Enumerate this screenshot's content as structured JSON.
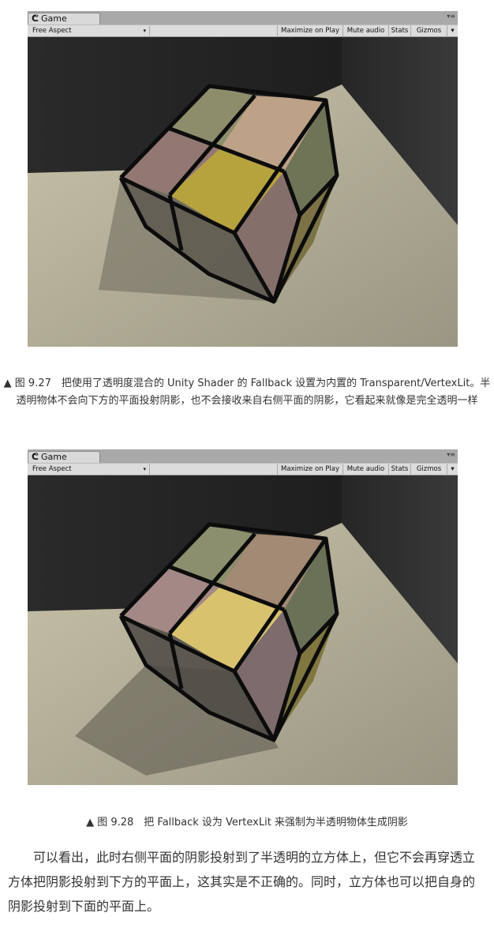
{
  "panels": [
    {
      "tab": {
        "icon": "unity-icon",
        "label": "Game"
      },
      "toolbar": {
        "aspect": "Free Aspect",
        "maximize": "Maximize on Play",
        "mute": "Mute audio",
        "stats": "Stats",
        "gizmos": "Gizmos"
      },
      "colors": {
        "face_top_left": "#8d8d6c",
        "face_top_right": "#bda288",
        "face_front_left": "#937772",
        "face_front_right": "#b7a33e",
        "side_top": "#6f7457",
        "side_bottom_left": "#856f6a",
        "side_bottom_right": "#7c7245"
      }
    },
    {
      "tab": {
        "icon": "unity-icon",
        "label": "Game"
      },
      "toolbar": {
        "aspect": "Free Aspect",
        "maximize": "Maximize on Play",
        "mute": "Mute audio",
        "stats": "Stats",
        "gizmos": "Gizmos"
      },
      "colors": {
        "face_top_left": "#8b8f6d",
        "face_top_right": "#a38a74",
        "face_front_left": "#a48885",
        "face_front_right": "#d9c26e",
        "side_top": "#6a7157",
        "side_bottom_left": "#7d6c6b",
        "side_bottom_right": "#7f773f"
      }
    }
  ],
  "captions": {
    "fig27": "▲ 图 9.27　把使用了透明度混合的 Unity Shader 的 Fallback 设置为内置的 Transparent/VertexLit。半透明物体不会向下方的平面投射阴影，也不会接收来自右侧平面的阴影，它看起来就像是完全透明一样",
    "fig28": "▲ 图 9.28　把 Fallback 设为 VertexLit 来强制为半透明物体生成阴影"
  },
  "body": "可以看出，此时右侧平面的阴影投射到了半透明的立方体上，但它不会再穿透立方体把阴影投射到下方的平面上，这其实是不正确的。同时，立方体也可以把自身的阴影投射到下面的平面上。"
}
